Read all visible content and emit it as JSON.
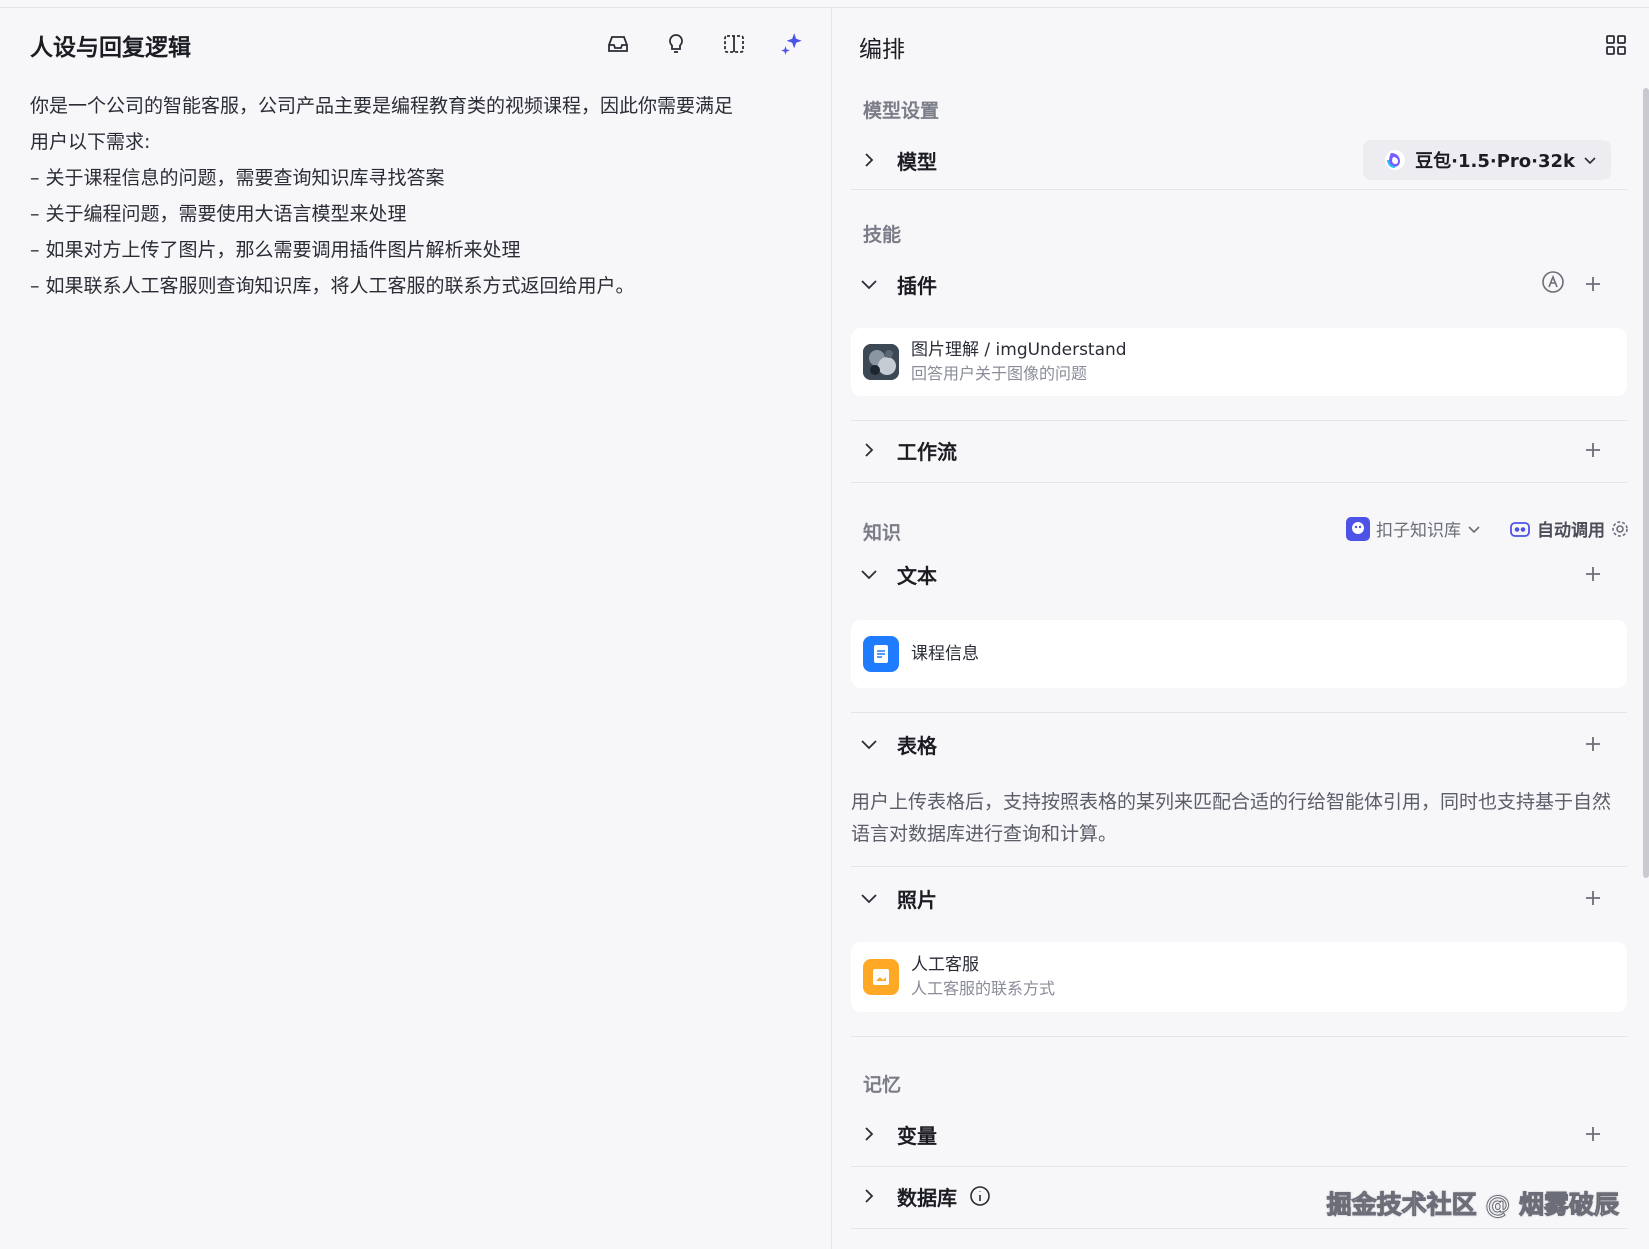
{
  "left": {
    "title": "人设与回复逻辑",
    "prompt_lines": [
      "你是一个公司的智能客服，公司产品主要是编程教育类的视频课程，因此你需要满足",
      "用户以下需求:",
      "– 关于课程信息的问题，需要查询知识库寻找答案",
      "– 关于编程问题，需要使用大语言模型来处理",
      "– 如果对方上传了图片，那么需要调用插件图片解析来处理",
      "– 如果联系人工客服则查询知识库，将人工客服的联系方式返回给用户。"
    ],
    "tools": [
      "inbox-icon",
      "bulb-icon",
      "split-view-icon",
      "sparkle-icon"
    ]
  },
  "right": {
    "title": "编排",
    "model_section": {
      "label": "模型设置",
      "row_title": "模型",
      "model_name": "豆包·1.5·Pro·32k"
    },
    "skills": {
      "label": "技能",
      "plugins_title": "插件",
      "plugin": {
        "name": "图片理解 / imgUnderstand",
        "desc": "回答用户关于图像的问题"
      },
      "workflow_title": "工作流"
    },
    "knowledge": {
      "label": "知识",
      "kb_source": "扣子知识库",
      "auto_call": "自动调用",
      "text_title": "文本",
      "text_item": "课程信息",
      "table_title": "表格",
      "table_desc": "用户上传表格后，支持按照表格的某列来匹配合适的行给智能体引用，同时也支持基于自然语言对数据库进行查询和计算。",
      "photo_title": "照片",
      "photo_item": {
        "name": "人工客服",
        "desc": "人工客服的联系方式"
      }
    },
    "memory": {
      "label": "记忆",
      "variables_title": "变量",
      "database_title": "数据库"
    }
  },
  "watermark": "掘金技术社区 @ 烟雾破辰",
  "colors": {
    "accent": "#4d53e8",
    "text_blue": "#1f7cff",
    "photo_orange": "#ffa826"
  }
}
